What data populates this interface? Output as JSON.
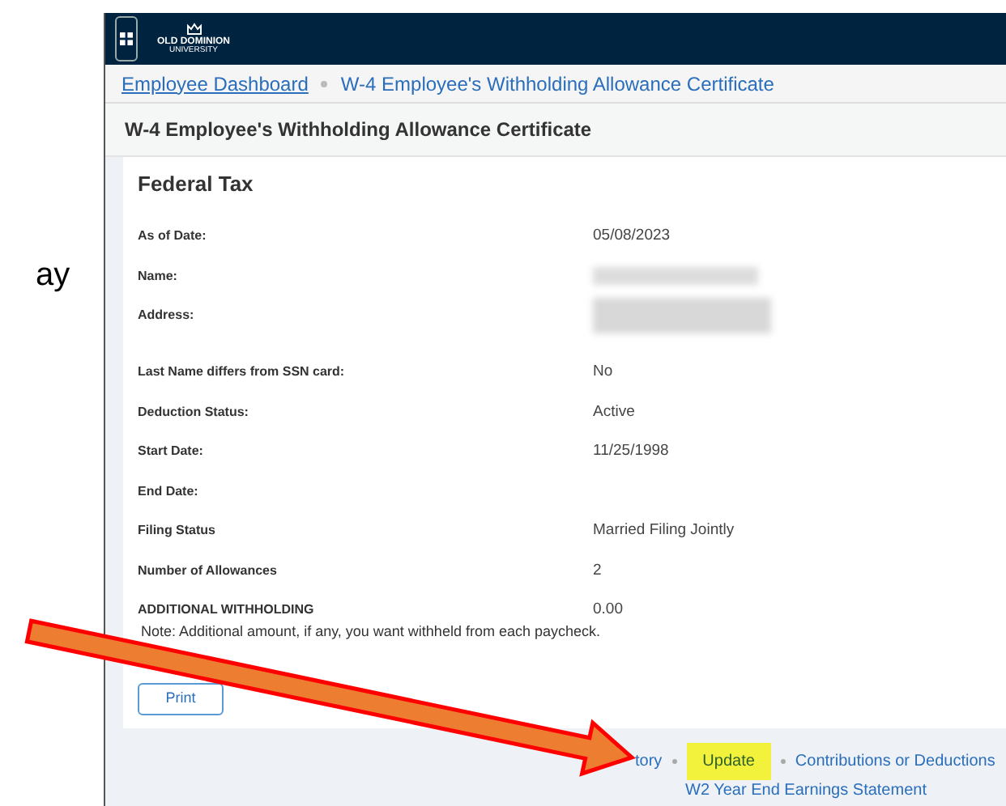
{
  "slide_text": "ay",
  "header": {
    "logo_text": "OLD DOMINION",
    "logo_subtext": "UNIVERSITY"
  },
  "breadcrumb": [
    {
      "label": "Employee Dashboard",
      "link": true
    },
    {
      "label": "W-4 Employee's Withholding Allowance Certificate",
      "link": false
    }
  ],
  "page_title": "W-4 Employee's Withholding Allowance Certificate",
  "card": {
    "title": "Federal Tax",
    "rows": [
      {
        "label": "As of Date:",
        "value": "05/08/2023"
      },
      {
        "label": "Name:",
        "kind": "redacted"
      },
      {
        "label": "Address:",
        "kind": "redacted_tall"
      },
      {
        "label": "Last Name differs from SSN card:",
        "value": "No"
      },
      {
        "label": "Deduction Status:",
        "value": "Active"
      },
      {
        "label": "Start Date:",
        "value": "11/25/1998"
      },
      {
        "label": "End Date:"
      },
      {
        "label": "Filing Status",
        "value": "Married Filing Jointly"
      },
      {
        "label": "Number of Allowances",
        "value": "2"
      },
      {
        "label": "ADDITIONAL WITHHOLDING",
        "value": "0.00"
      }
    ],
    "note": "Note: Additional amount, if any, you want withheld from each paycheck.",
    "button": "Print"
  },
  "footer_links": [
    {
      "label": "tory",
      "highlighted": false
    },
    {
      "label": "Update",
      "highlighted": true
    },
    {
      "label": "Contributions or Deductions",
      "highlighted": false
    }
  ],
  "footer_link_2": "W2 Year End Earnings Statement"
}
